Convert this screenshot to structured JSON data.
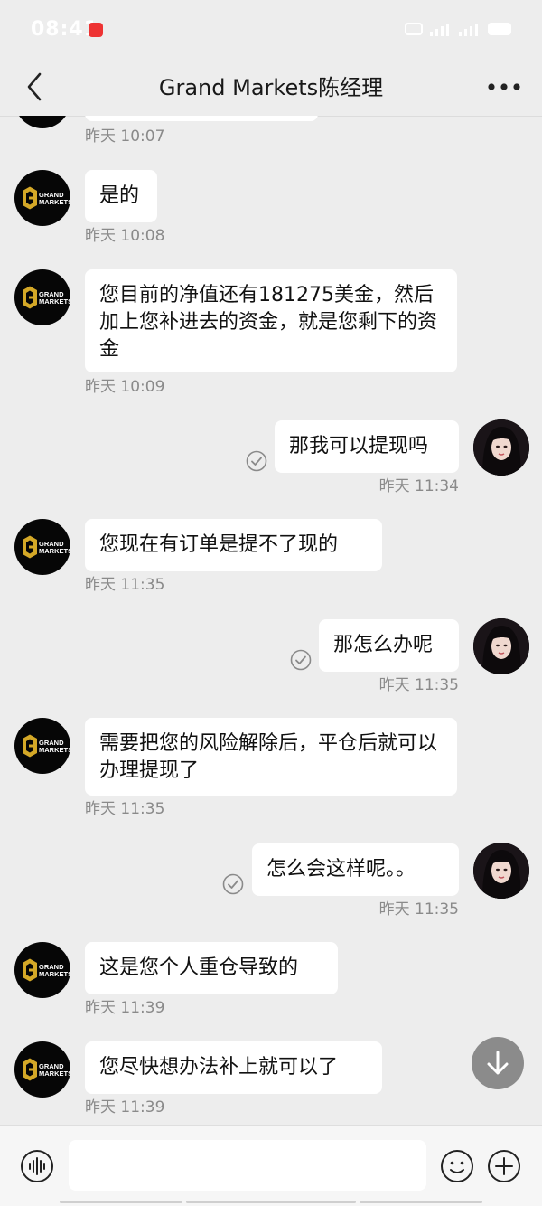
{
  "status_bar": {
    "time": "08:41"
  },
  "header": {
    "title": "Grand Markets陈经理"
  },
  "messages": [
    {
      "text": "",
      "time": "昨天 10:07"
    },
    {
      "text": "是的",
      "time": "昨天 10:08"
    },
    {
      "text": "您目前的净值还有181275美金，然后加上您补进去的资金，就是您剩下的资金",
      "time": "昨天 10:09"
    },
    {
      "text": "那我可以提现吗",
      "time": "昨天 11:34"
    },
    {
      "text": "您现在有订单是提不了现的",
      "time": "昨天 11:35"
    },
    {
      "text": "那怎么办呢",
      "time": "昨天 11:35"
    },
    {
      "text": "需要把您的风险解除后，平仓后就可以办理提现了",
      "time": "昨天 11:35"
    },
    {
      "text": "怎么会这样呢。。",
      "time": "昨天 11:35"
    },
    {
      "text": "这是您个人重仓导致的",
      "time": "昨天 11:39"
    },
    {
      "text": "您尽快想办法补上就可以了",
      "time": "昨天 11:39"
    }
  ],
  "avatar_logo": {
    "line1": "GRAND",
    "line2": "MARKETS"
  },
  "input": {
    "value": "",
    "placeholder": ""
  },
  "icons": {
    "back": "chevron-left-icon",
    "more": "more-dots-icon",
    "read": "check-circle-icon",
    "scroll": "arrow-down-icon",
    "voice": "voice-icon",
    "emoji": "emoji-icon",
    "plus": "plus-icon"
  },
  "colors": {
    "background": "#ededed",
    "bubble": "#ffffff",
    "logo_accent": "#d4a827",
    "timestamp": "#8a8a8a"
  }
}
